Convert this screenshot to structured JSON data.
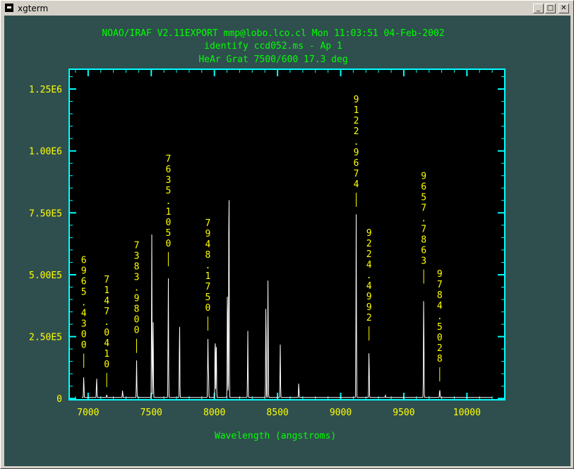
{
  "window": {
    "title": "xgterm",
    "buttons": [
      "_",
      "□",
      "✕"
    ]
  },
  "header": {
    "line1": "NOAO/IRAF V2.11EXPORT mmp@lobo.lco.cl Mon 11:03:51 04-Feb-2002",
    "line2": "identify ccd052.ms - Ap 1",
    "line3": "HeAr Grat 7500/600 17.3 deg"
  },
  "colors": {
    "background": "#2f4f4f",
    "plot_bg": "#000000",
    "frame": "#00ffff",
    "labels": "#ffff00",
    "title": "#00ff00",
    "spectrum": "#ffffff"
  },
  "chart_data": {
    "type": "line",
    "xlabel": "Wavelength (angstroms)",
    "xlim": [
      6850,
      10300
    ],
    "ylim": [
      -5000,
      1330000
    ],
    "x_ticks": [
      "7000",
      "7500",
      "8000",
      "8500",
      "9000",
      "9500",
      "10000"
    ],
    "y_ticks": [
      "0",
      "2.50E5",
      "5.00E5",
      "7.50E5",
      "1.00E6",
      "1.25E6"
    ],
    "continuum": 4000,
    "series": [
      {
        "lines": [
          {
            "x": 6965.43,
            "y": 90000
          },
          {
            "x": 7067.2,
            "y": 85000
          },
          {
            "x": 7147.04,
            "y": 12000
          },
          {
            "x": 7272.9,
            "y": 30000
          },
          {
            "x": 7383.98,
            "y": 150000
          },
          {
            "x": 7503.87,
            "y": 670000
          },
          {
            "x": 7514.65,
            "y": 330000
          },
          {
            "x": 7635.11,
            "y": 500000
          },
          {
            "x": 7724.2,
            "y": 320000
          },
          {
            "x": 7948.18,
            "y": 240000
          },
          {
            "x": 7953.0,
            "y": 110000
          },
          {
            "x": 8006.16,
            "y": 280000
          },
          {
            "x": 8014.79,
            "y": 240000
          },
          {
            "x": 8103.69,
            "y": 500000
          },
          {
            "x": 8115.31,
            "y": 980000
          },
          {
            "x": 8264.52,
            "y": 270000
          },
          {
            "x": 8408.21,
            "y": 410000
          },
          {
            "x": 8424.65,
            "y": 500000
          },
          {
            "x": 8521.44,
            "y": 220000
          },
          {
            "x": 8667.94,
            "y": 60000
          },
          {
            "x": 9122.97,
            "y": 740000
          },
          {
            "x": 9224.5,
            "y": 200000
          },
          {
            "x": 9354.22,
            "y": 10000
          },
          {
            "x": 9657.79,
            "y": 430000
          },
          {
            "x": 9784.5,
            "y": 35000
          }
        ]
      }
    ],
    "annotations": [
      {
        "text": "6965.4300",
        "x": 6965.43,
        "y": 90000
      },
      {
        "text": "7147.0410",
        "x": 7147.04,
        "y": 12000
      },
      {
        "text": "7383.9800",
        "x": 7383.98,
        "y": 150000
      },
      {
        "text": "7635.1050",
        "x": 7635.11,
        "y": 500000
      },
      {
        "text": "7948.1750",
        "x": 7948.18,
        "y": 240000
      },
      {
        "text": "9122.9674",
        "x": 9122.97,
        "y": 740000
      },
      {
        "text": "9224.4992",
        "x": 9224.5,
        "y": 200000
      },
      {
        "text": "9657.7863",
        "x": 9657.79,
        "y": 430000
      },
      {
        "text": "9784.5028",
        "x": 9784.5,
        "y": 35000
      }
    ]
  }
}
